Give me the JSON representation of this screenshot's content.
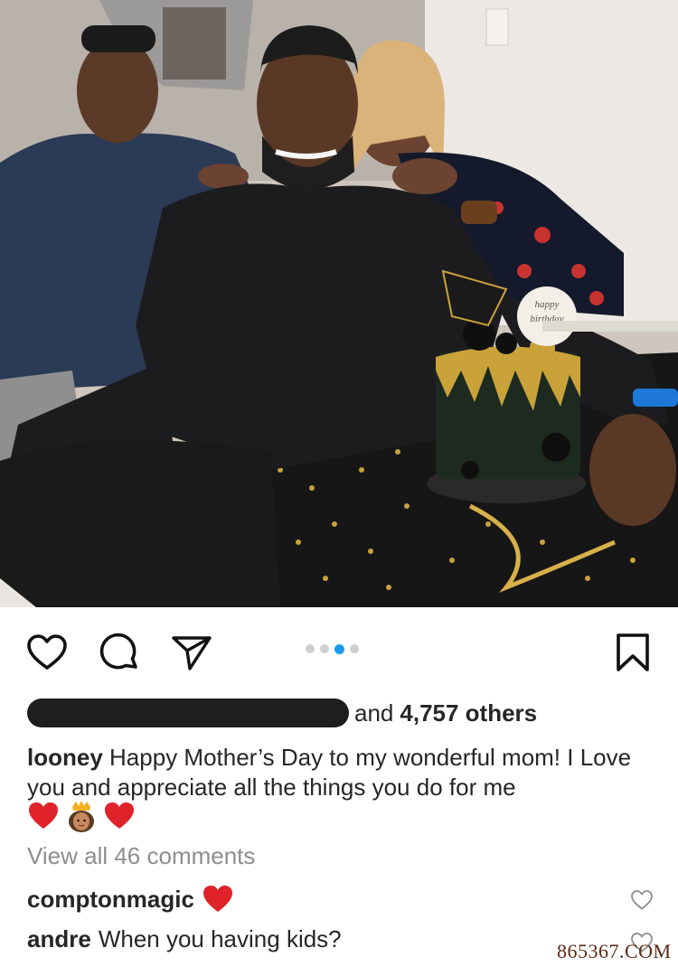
{
  "photo": {
    "alt_icon": "family-birthday-photo",
    "cake_topper_text": "happy birthday"
  },
  "actions": {
    "like_icon": "heart-icon",
    "comment_icon": "comment-bubble-icon",
    "share_icon": "paper-plane-icon",
    "save_icon": "bookmark-icon",
    "carousel_total": 4,
    "carousel_active_index": 3,
    "active_dot_color": "#1d9bf0"
  },
  "likes": {
    "prefix": "and",
    "count_text": "4,757 others"
  },
  "caption": {
    "username": "looney",
    "text": "Happy Mother’s Day to my wonderful mom! I Love you and appreciate all the things you do for me",
    "emojis": [
      "red-heart-emoji",
      "woman-with-crown-emoji",
      "red-heart-emoji"
    ]
  },
  "view_all": "View all 46 comments",
  "comments": [
    {
      "username": "comptonmagic",
      "text": "",
      "emoji": "red-heart-emoji"
    },
    {
      "username": "andre",
      "text": "When you having kids?"
    }
  ],
  "watermark": "865367.COM"
}
